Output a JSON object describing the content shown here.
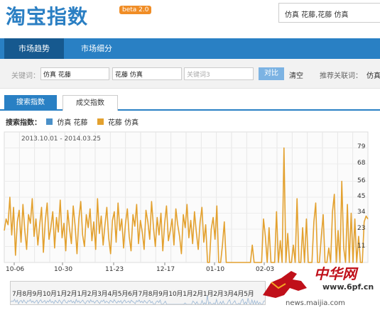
{
  "header": {
    "logo": "淘宝指数",
    "beta": "beta 2.0",
    "search_value": "仿真 花藤,花藤 仿真"
  },
  "nav": {
    "items": [
      {
        "label": "市场趋势",
        "active": true
      },
      {
        "label": "市场细分",
        "active": false
      }
    ]
  },
  "keywords": {
    "label": "关键词：",
    "kw1": "仿真 花藤",
    "kw2": "花藤 仿真",
    "kw3_placeholder": "关键词3",
    "compare": "对比",
    "clear": "清空",
    "recommend_label": "推荐关联词：",
    "recommend_item": "仿真"
  },
  "tabs": [
    {
      "label": "搜索指数",
      "active": true
    },
    {
      "label": "成交指数",
      "active": false
    }
  ],
  "legend": {
    "title": "搜索指数：",
    "series": [
      {
        "name": "仿真 花藤",
        "color": "#4a90c8"
      },
      {
        "name": "花藤 仿真",
        "color": "#e3a12f"
      }
    ]
  },
  "chart_data": {
    "type": "line",
    "date_range": "2013.10.01 - 2014.03.25",
    "x_tick_labels": [
      "10-06",
      "10-30",
      "11-23",
      "12-17",
      "01-10",
      "02-03"
    ],
    "y_tick_labels": [
      "79",
      "68",
      "56",
      "45",
      "34",
      "23",
      "11"
    ],
    "ylim": [
      0,
      90
    ],
    "grid": true,
    "series": [
      {
        "name": "花藤 仿真",
        "color": "#e3a12f",
        "values": [
          22,
          30,
          26,
          45,
          19,
          38,
          5,
          28,
          36,
          14,
          40,
          22,
          9,
          33,
          27,
          44,
          18,
          30,
          12,
          26,
          38,
          7,
          29,
          41,
          16,
          24,
          35,
          10,
          31,
          21,
          43,
          17,
          27,
          8,
          36,
          23,
          13,
          39,
          25,
          6,
          30,
          42,
          19,
          11,
          33,
          24,
          37,
          15,
          28,
          9,
          44,
          20,
          32,
          12,
          26,
          38,
          17,
          6,
          29,
          35,
          14,
          41,
          22,
          30,
          10,
          27,
          37,
          18,
          8,
          33,
          25,
          40,
          13,
          29,
          21,
          9,
          36,
          28,
          16,
          42,
          24,
          11,
          31,
          19,
          34,
          8,
          27,
          39,
          15,
          22,
          30,
          12,
          37,
          26,
          18,
          6,
          33,
          24,
          40,
          17,
          29,
          13,
          35,
          21,
          9,
          28,
          38,
          14,
          26,
          0,
          0,
          23,
          31,
          16,
          39,
          0,
          0,
          12,
          28,
          0,
          0,
          0,
          0,
          0,
          0,
          0,
          0,
          0,
          0,
          0,
          0,
          0,
          0,
          12,
          0,
          0,
          0,
          0,
          0,
          30,
          18,
          0,
          24,
          0,
          0,
          0,
          35,
          0,
          15,
          0,
          79,
          0,
          20,
          0,
          0,
          12,
          0,
          44,
          0,
          0,
          24,
          0,
          30,
          0,
          0,
          0,
          28,
          41,
          0,
          0,
          18,
          33,
          0,
          0,
          10,
          0,
          35,
          47,
          0,
          22,
          0,
          56,
          10,
          0,
          40,
          0,
          34,
          0,
          30,
          0,
          18,
          0,
          0,
          28,
          32,
          30
        ]
      }
    ]
  },
  "navigator": {
    "labels": "7月8月9月10月1月2月1月2月3月4月5月6月7月8月9月10月1月2月1月2月3月4月5月"
  },
  "watermark": {
    "brand": "中华网",
    "site": "www.6pf.cn",
    "url": "news.maijia.com"
  }
}
